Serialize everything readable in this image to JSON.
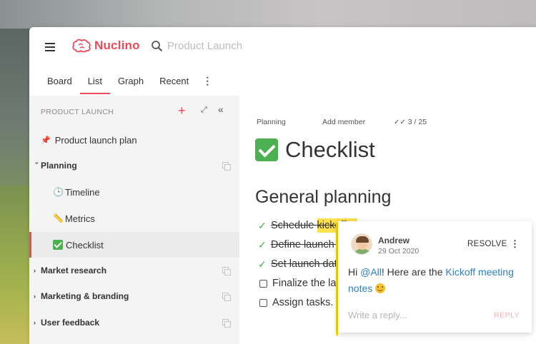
{
  "app": {
    "logo_text": "Nuclino",
    "search_placeholder": "Product Launch",
    "accent_color": "#ee4a57"
  },
  "tabs": [
    {
      "label": "Board",
      "active": false
    },
    {
      "label": "List",
      "active": true
    },
    {
      "label": "Graph",
      "active": false
    },
    {
      "label": "Recent",
      "active": false
    }
  ],
  "tabs_more": "⋮",
  "sidebar": {
    "title": "PRODUCT LAUNCH",
    "plus": "+",
    "expand": "⤢",
    "collapse": "«",
    "items": [
      {
        "label": "Product launch plan",
        "icon": "pin-icon",
        "icon_glyph": "📌"
      },
      {
        "label": "Planning",
        "caret": "›",
        "bold": true
      },
      {
        "label": "Timeline",
        "icon": "clock-icon",
        "icon_glyph": "🕒"
      },
      {
        "label": "Metrics",
        "icon": "ruler-icon",
        "icon_glyph": "📏"
      },
      {
        "label": "Checklist",
        "icon": "check-icon",
        "selected": true
      },
      {
        "label": "Market research",
        "caret": "›",
        "bold": true
      },
      {
        "label": "Marketing & branding",
        "caret": "›",
        "bold": true
      },
      {
        "label": "User feedback",
        "caret": "›",
        "bold": true
      }
    ]
  },
  "doc": {
    "meta_cluster": "Planning",
    "meta_add_member": "Add member",
    "meta_tasks": "3 / 25",
    "title": "Checklist",
    "heading": "General planning",
    "tasks": [
      {
        "before": "Schedule ",
        "highlight": "kickoff m",
        "done": true
      },
      {
        "text": "Define launch targe",
        "done": true
      },
      {
        "text": "Set launch date.",
        "done": true
      },
      {
        "text": "Finalize the launch",
        "done": false
      },
      {
        "text": "Assign tasks.",
        "done": false
      }
    ]
  },
  "comment": {
    "author": "Andrew",
    "date": "29 Oct 2020",
    "resolve_label": "RESOLVE",
    "more": "⋮",
    "text_before": "Hi ",
    "mention": "@All",
    "text_mid": "! Here are the ",
    "link": "Kickoff meeting notes",
    "reply_placeholder": "Write a reply...",
    "reply_button": "REPLY",
    "highlight_color": "#f5d20a"
  }
}
